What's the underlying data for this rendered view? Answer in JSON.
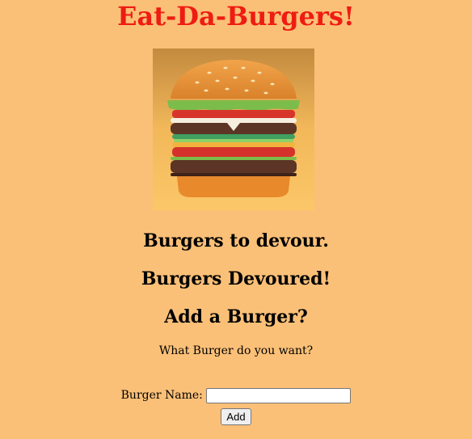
{
  "header": {
    "title": "Eat-Da-Burgers!"
  },
  "hero": {
    "image_name": "burger-image"
  },
  "sections": {
    "to_devour": "Burgers to devour.",
    "devoured": "Burgers Devoured!",
    "add": "Add a Burger?"
  },
  "form": {
    "prompt": "What Burger do you want?",
    "name_label": "Burger Name:",
    "name_value": "",
    "add_label": "Add"
  },
  "colors": {
    "page_background": "#fbc077",
    "title": "#ee1c12"
  }
}
